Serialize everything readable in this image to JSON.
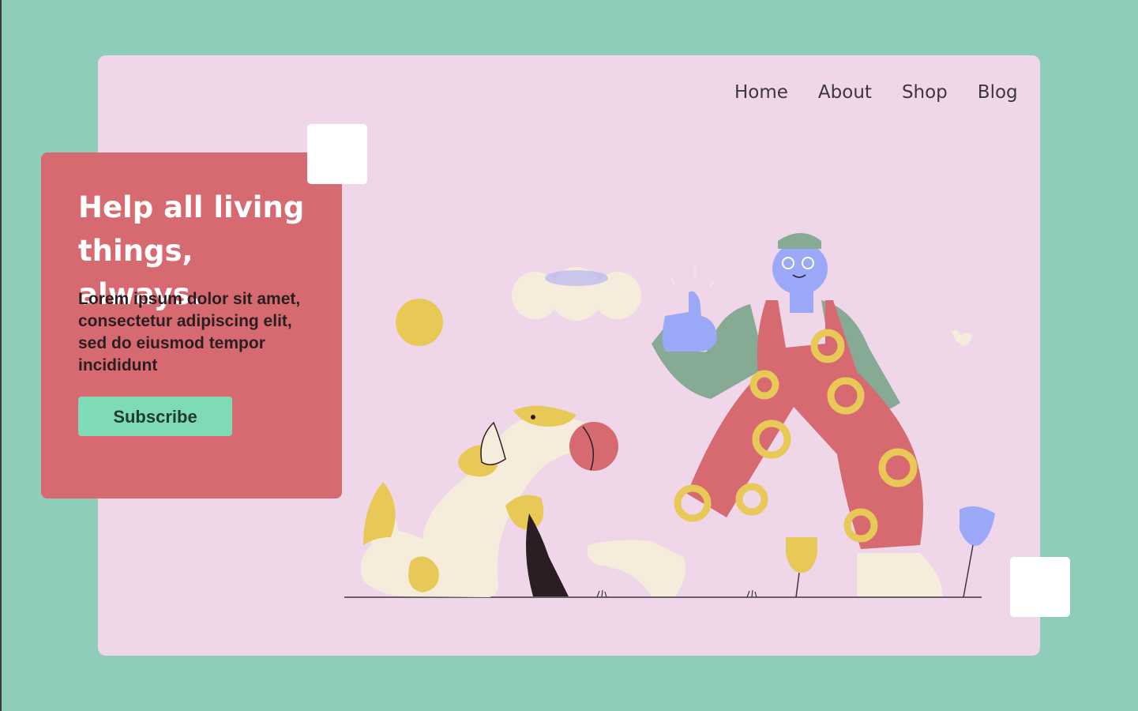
{
  "nav": {
    "items": [
      {
        "label": "Home"
      },
      {
        "label": "About"
      },
      {
        "label": "Shop"
      },
      {
        "label": "Blog"
      }
    ]
  },
  "hero": {
    "title": "Help all living things, always.",
    "body": "Lorem ipsum dolor sit amet, consectetur adipiscing elit, sed do eiusmod tempor incididunt",
    "cta_label": "Subscribe"
  },
  "colors": {
    "page_bg": "#8ecdb9",
    "card_bg": "#efd6e8",
    "hero_bg": "#d66a70",
    "button_bg": "#7fdbb5",
    "accent_yellow": "#e8c957",
    "accent_blue": "#9aa8f7"
  },
  "illustration": {
    "subject": "person-giving-thumbs-up-to-dog-with-ball",
    "icons": [
      "sun-icon",
      "cloud-icon",
      "dog-icon",
      "ball-icon",
      "person-icon",
      "flower-icon"
    ]
  }
}
